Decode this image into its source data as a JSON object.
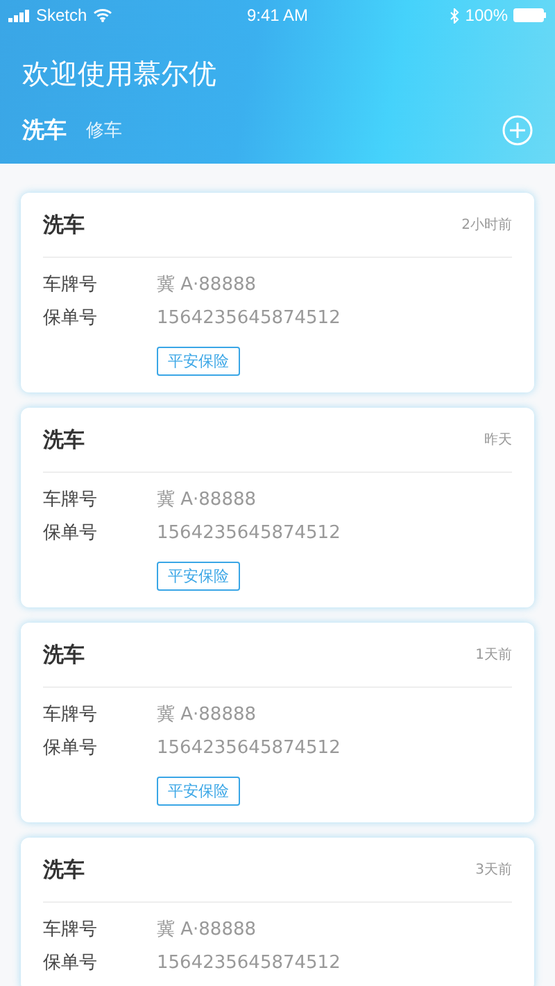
{
  "status_bar": {
    "carrier": "Sketch",
    "time": "9:41 AM",
    "battery": "100%"
  },
  "header": {
    "title": "欢迎使用慕尔优"
  },
  "tabs": [
    {
      "label": "洗车",
      "selected": true
    },
    {
      "label": "修车",
      "selected": false
    }
  ],
  "cards": [
    {
      "title": "洗车",
      "time": "2小时前",
      "fields": [
        {
          "label": "车牌号",
          "value": "冀 A·88888"
        },
        {
          "label": "保单号",
          "value": "1564235645874512"
        }
      ],
      "badge": "平安保险"
    },
    {
      "title": "洗车",
      "time": "昨天",
      "fields": [
        {
          "label": "车牌号",
          "value": "冀 A·88888"
        },
        {
          "label": "保单号",
          "value": "1564235645874512"
        }
      ],
      "badge": "平安保险"
    },
    {
      "title": "洗车",
      "time": "1天前",
      "fields": [
        {
          "label": "车牌号",
          "value": "冀 A·88888"
        },
        {
          "label": "保单号",
          "value": "1564235645874512"
        }
      ],
      "badge": "平安保险"
    },
    {
      "title": "洗车",
      "time": "3天前",
      "fields": [
        {
          "label": "车牌号",
          "value": "冀 A·88888"
        },
        {
          "label": "保单号",
          "value": "1564235645874512"
        }
      ]
    }
  ]
}
